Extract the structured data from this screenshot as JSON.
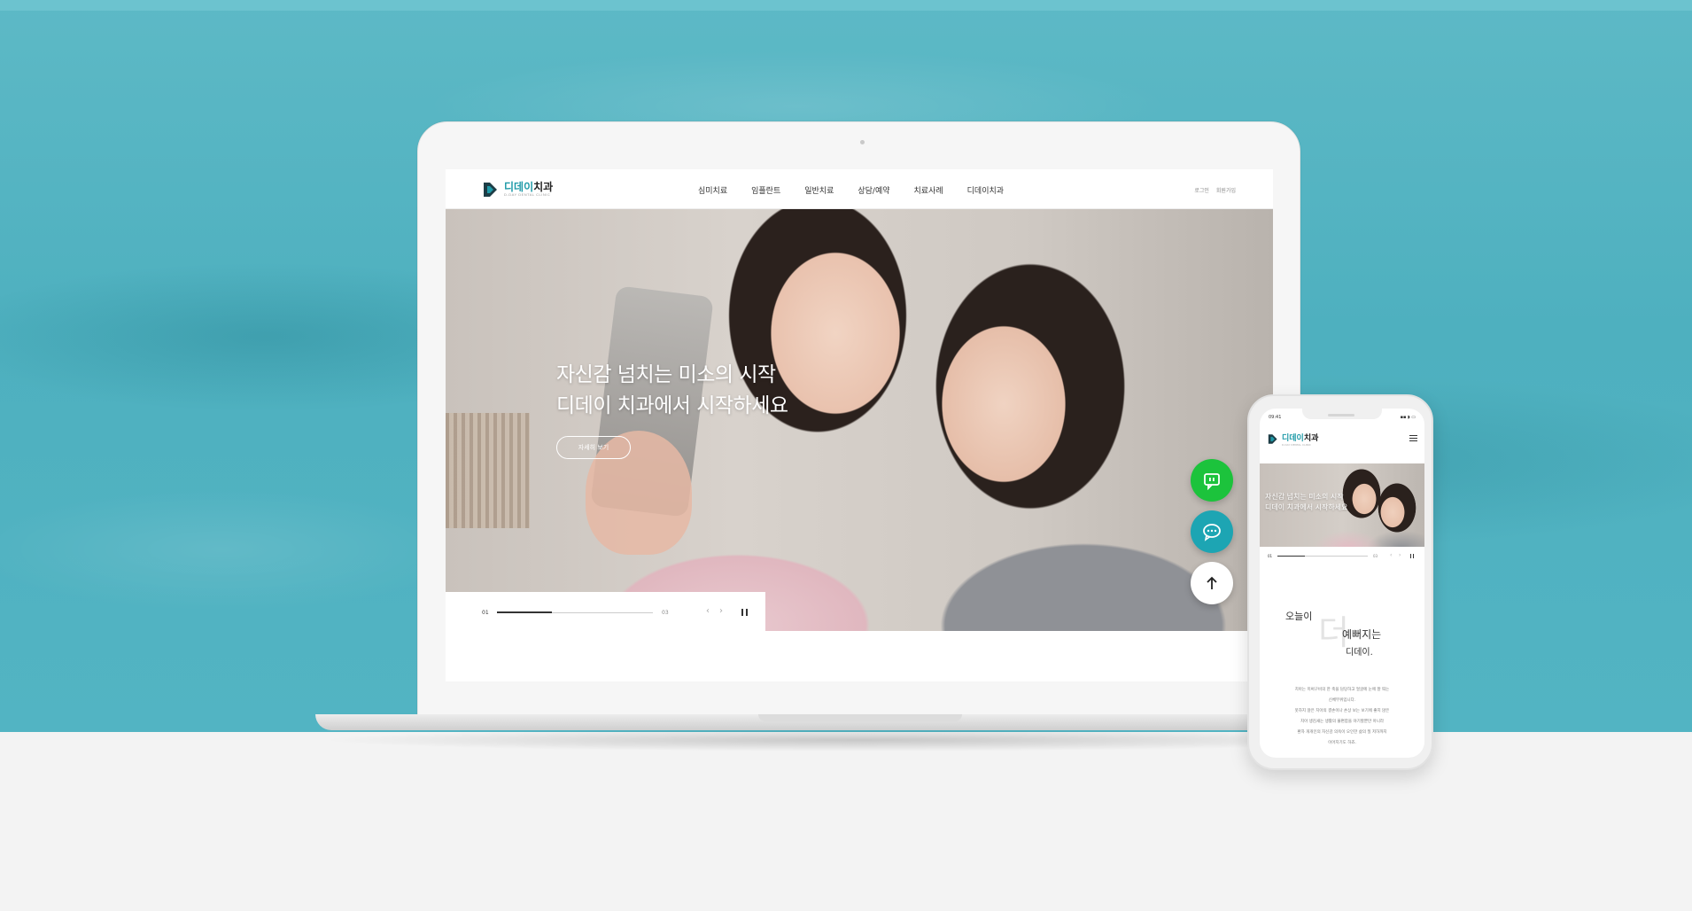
{
  "desktop": {
    "logo": {
      "title_accent": "디데이",
      "title_rest": "치과",
      "subtitle": "D-DAY DENTAL CLINIC"
    },
    "nav": [
      "심미치료",
      "임플란트",
      "일반치료",
      "상담/예약",
      "치료사례",
      "디데이치과"
    ],
    "util": [
      "로그인",
      "회원가입"
    ],
    "hero": {
      "line1": "자신감 넘치는 미소의 시작",
      "line2": "디데이 치과에서 시작하세요",
      "button": "자세히 보기"
    },
    "slider": {
      "current": "01",
      "total": "03",
      "progress": 0.35,
      "prev": "‹",
      "next": "›"
    }
  },
  "floating": {
    "talk_icon": "kakao-talk-icon",
    "chat_icon": "chat-bubble-icon",
    "top_icon": "arrow-up-icon"
  },
  "mobile": {
    "status_time": "09:41",
    "status_icons": "▪▪ ◗ ▭",
    "logo": {
      "title_accent": "디데이",
      "title_rest": "치과",
      "subtitle": "D-DAY DENTAL CLINIC"
    },
    "hero": {
      "line1": "자신감 넘치는 미소의 시작",
      "line2": "디데이 치과에서 시작하세요"
    },
    "slider": {
      "current": "01",
      "total": "03",
      "progress": 0.3,
      "prev": "‹",
      "next": "›"
    },
    "intro": {
      "line1": "오늘이",
      "big": "더",
      "line2": "예뻐지는",
      "line3": "디데이."
    },
    "body": [
      "치아는 미써구비의 한 축을 담당하고 얼굴에 눈에 잘 띄는",
      "신체부위입니다.",
      "못하지 않은 치아의 결손이나 손상 보는 보기에 좋지 않은",
      "치아 생김새는 생활의 불편함을 야기할뿐만 아니라",
      "환자 개개인의 자신감 의욕이 오인한 삶의 질 저하까지",
      "이어지기도 하죠."
    ]
  },
  "colors": {
    "brand": "#1f9aa8",
    "talk": "#1cc33c",
    "chat": "#1da5b3",
    "sea": "#52b4c3"
  }
}
